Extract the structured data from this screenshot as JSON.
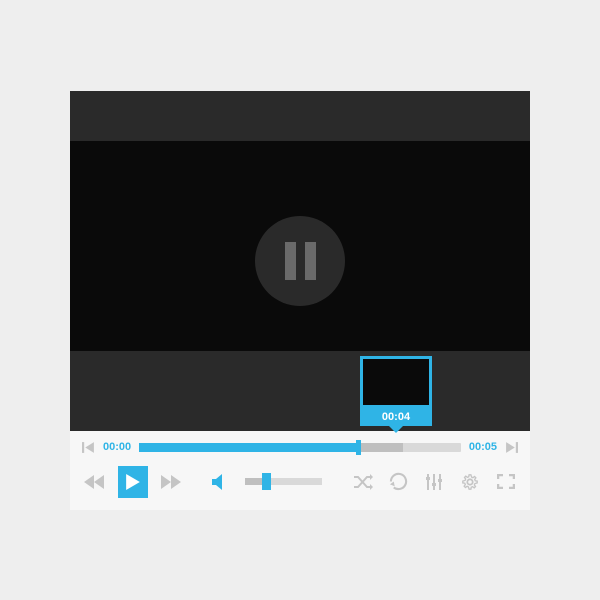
{
  "colors": {
    "accent": "#2fb4e6",
    "muted": "#c5c5c5"
  },
  "playback": {
    "current_time": "00:00",
    "total_time": "00:05",
    "preview_time": "00:04",
    "progress_percent": 68,
    "buffer_percent": 82,
    "state": "paused"
  },
  "volume": {
    "level_percent": 28
  },
  "icons": {
    "prev_track": "previous-track-icon",
    "next_track": "next-track-icon",
    "rewind": "rewind-icon",
    "play": "play-icon",
    "forward": "forward-icon",
    "volume": "volume-icon",
    "shuffle": "shuffle-icon",
    "repeat": "repeat-icon",
    "equalizer": "equalizer-icon",
    "settings": "settings-icon",
    "fullscreen": "fullscreen-icon",
    "pause_center": "pause-icon"
  }
}
